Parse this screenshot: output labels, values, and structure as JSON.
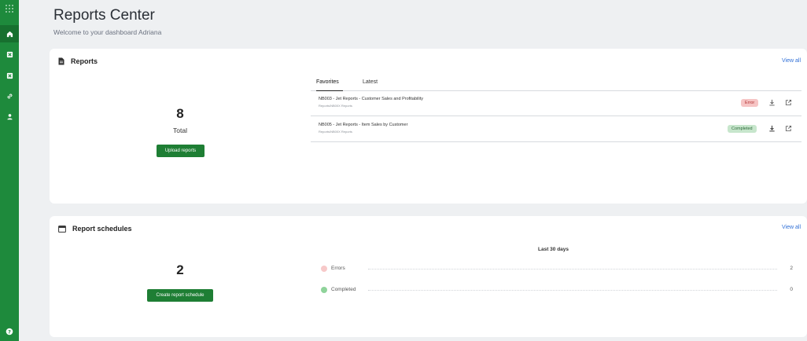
{
  "colors": {
    "sidebar": "#1e8a3c",
    "accent_button": "#1e7e34",
    "link": "#2f6fd6",
    "error_badge": "#f6c4c4",
    "completed_badge": "#c7e6cc"
  },
  "sidebar": {
    "icons": [
      "apps-grid-icon",
      "home-icon",
      "excel-icon",
      "excel-icon",
      "link-icon",
      "user-icon",
      "help-icon"
    ],
    "active": "home-icon"
  },
  "header": {
    "title": "Reports Center",
    "subtitle": "Welcome to your dashboard Adriana"
  },
  "reports": {
    "title": "Reports",
    "view_all": "View all",
    "total_count": "8",
    "total_label": "Total",
    "upload_button": "Upload reports",
    "tabs": [
      {
        "label": "Favorites",
        "active": true
      },
      {
        "label": "Latest",
        "active": false
      }
    ],
    "rows": [
      {
        "name": "NB003 - Jet Reports - Customer Sales and Profitability",
        "path": "Reports/NB00X Reports",
        "status": "Error"
      },
      {
        "name": "NB005 - Jet Reports - Item Sales by Customer",
        "path": "Reports/NB00X Reports",
        "status": "Completed"
      }
    ]
  },
  "schedules": {
    "title": "Report schedules",
    "view_all": "View all",
    "total_count": "2",
    "create_button": "Create report schedule",
    "period_label": "Last 30 days",
    "legend": [
      {
        "label": "Errors",
        "count": "2",
        "color": "#f7c9c9"
      },
      {
        "label": "Completed",
        "count": "0",
        "color": "#8fd39a"
      }
    ]
  }
}
